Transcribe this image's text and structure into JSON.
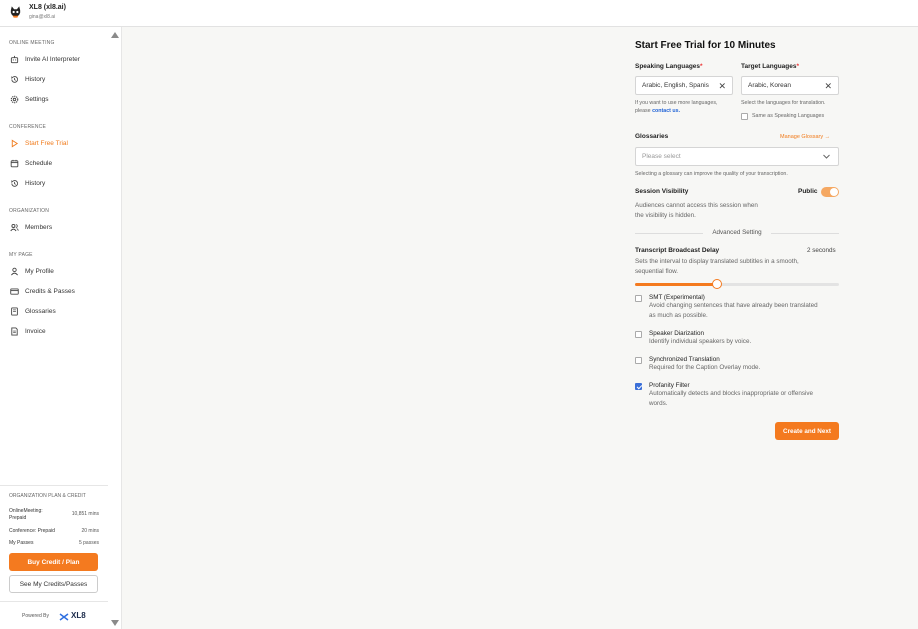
{
  "account": {
    "name": "XL8 (xl8.ai)",
    "email": "gina@xl8.ai"
  },
  "sidebar": {
    "online_meeting": {
      "heading": "ONLINE MEETING",
      "items": [
        {
          "label": "Invite AI Interpreter",
          "icon": "robot-icon"
        },
        {
          "label": "History",
          "icon": "history-icon"
        },
        {
          "label": "Settings",
          "icon": "gear-icon"
        }
      ]
    },
    "conference": {
      "heading": "CONFERENCE",
      "items": [
        {
          "label": "Start Free Trial",
          "icon": "play-icon"
        },
        {
          "label": "Schedule",
          "icon": "calendar-icon"
        },
        {
          "label": "History",
          "icon": "history-icon"
        }
      ]
    },
    "organization": {
      "heading": "ORGANIZATION",
      "items": [
        {
          "label": "Members",
          "icon": "members-icon"
        }
      ]
    },
    "my_page": {
      "heading": "MY PAGE",
      "items": [
        {
          "label": "My Profile",
          "icon": "user-icon"
        },
        {
          "label": "Credits & Passes",
          "icon": "card-icon"
        },
        {
          "label": "Glossaries",
          "icon": "book-icon"
        },
        {
          "label": "Invoice",
          "icon": "invoice-icon"
        }
      ]
    },
    "plan": {
      "heading": "ORGANIZATION PLAN & CREDIT",
      "online_label_1": "OnlineMeeting:",
      "online_label_2": "Prepaid",
      "online_value": "10,851 mins",
      "conference_label": "Conference: Prepaid",
      "conference_value": "20 mins",
      "passes_label": "My Passes",
      "passes_value": "5 passes"
    },
    "buy_label": "Buy Credit / Plan",
    "see_label": "See My Credits/Passes",
    "powered_by": "Powered By",
    "brand": "XL8"
  },
  "form": {
    "title": "Start Free Trial for 10 Minutes",
    "speaking_label": "Speaking Languages",
    "speaking_value": "Arabic, English, Spanis",
    "speaking_hint_1": "If you want to use more languages,",
    "speaking_hint_2": "please",
    "speaking_hint_link": "contact us.",
    "target_label": "Target Languages",
    "target_value": "Arabic, Korean",
    "target_hint": "Select the languages for translation.",
    "same_as_label": "Same as Speaking Languages",
    "required_mark": "*",
    "glossaries_label": "Glossaries",
    "manage_glossary": "Manage Glossary",
    "manage_arrow": "→",
    "glossary_placeholder": "Please select",
    "glossary_hint": "Selecting a glossary can improve the quality of your transcription.",
    "visibility_label": "Session Visibility",
    "visibility_state": "Public",
    "visibility_on": true,
    "visibility_desc_1": "Audiences cannot access this session when",
    "visibility_desc_2": "the visibility is hidden.",
    "advanced_heading": "Advanced Setting",
    "delay_label": "Transcript Broadcast Delay",
    "delay_value": "2 seconds",
    "delay_desc_1": "Sets the interval to display translated subtitles in a smooth,",
    "delay_desc_2": "sequential flow.",
    "delay_fraction": 0.4,
    "options": [
      {
        "title": "SMT (Experimental)",
        "desc_1": "Avoid changing sentences that have already been translated",
        "desc_2": "as much as possible.",
        "checked": false
      },
      {
        "title": "Speaker Diarization",
        "desc_1": "Identify individual speakers by voice.",
        "desc_2": "",
        "checked": false
      },
      {
        "title": "Synchronized Translation",
        "desc_1": "Required for the Caption Overlay mode.",
        "desc_2": "",
        "checked": false
      },
      {
        "title": "Profanity Filter",
        "desc_1": "Automatically detects and blocks inappropriate or offensive",
        "desc_2": "words.",
        "checked": true
      }
    ],
    "create_label": "Create and Next",
    "accent": "#f47a1f"
  }
}
